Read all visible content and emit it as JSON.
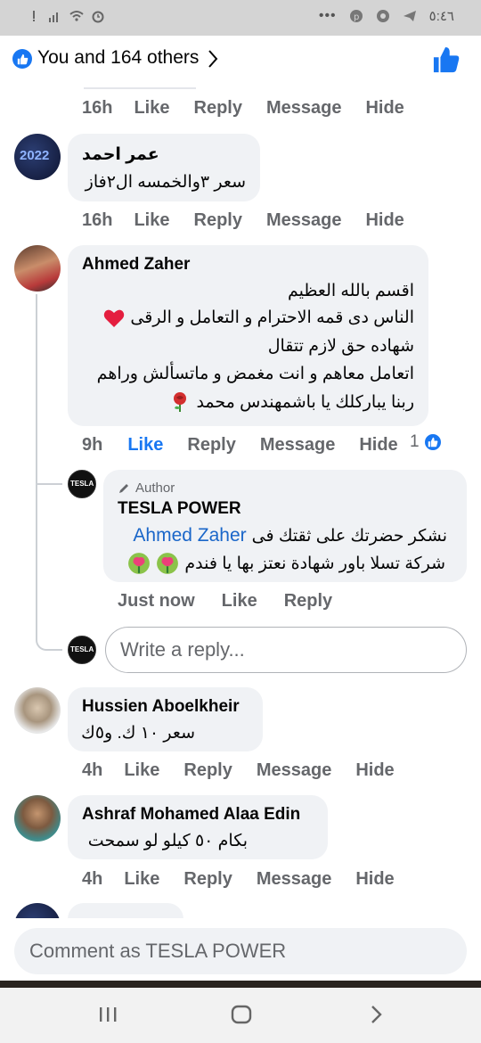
{
  "status_bar": {
    "time": "٥:٤٦",
    "dots": "•••"
  },
  "reactions": {
    "summary": "You and 164 others"
  },
  "comments": [
    {
      "time": "16h",
      "like": "Like",
      "reply": "Reply",
      "message": "Message",
      "hide": "Hide"
    },
    {
      "name": "عمر احمد",
      "lines": [
        "سعر ٣والخمسه ال٢فاز"
      ],
      "time": "16h",
      "like": "Like",
      "reply": "Reply",
      "message": "Message",
      "hide": "Hide",
      "avatar_text": "2022"
    },
    {
      "name": "Ahmed Zaher",
      "lines": [
        "اقسم بالله العظيم",
        "الناس دى قمه الاحترام و التعامل و الرقى",
        "شهاده حق لازم تتقال",
        "اتعامل معاهم و انت مغمض و ماتسألش وراهم",
        "ربنا يباركلك يا باشمهندس محمد"
      ],
      "time": "9h",
      "like": "Like",
      "reply": "Reply",
      "message": "Message",
      "hide": "Hide",
      "reaction_count": "1"
    },
    {
      "name": "Hussien Aboelkheir",
      "lines": [
        "سعر ١٠ ك.  و٥ك"
      ],
      "time": "4h",
      "like": "Like",
      "reply": "Reply",
      "message": "Message",
      "hide": "Hide"
    },
    {
      "name": "Ashraf Mohamed Alaa Edin",
      "lines": [
        "بكام ٥٠ كيلو لو سمحت"
      ],
      "time": "4h",
      "like": "Like",
      "reply": "Reply",
      "message": "Message",
      "hide": "Hide"
    }
  ],
  "author_reply": {
    "badge": "Author",
    "name": "TESLA POWER",
    "mention": "Ahmed Zaher",
    "line1_rest": "نشكر حضرتك على ثقتك فى",
    "line2": "شركة تسلا باور شهادة نعتز بها يا فندم",
    "time": "Just now",
    "like": "Like",
    "reply": "Reply",
    "avatar_text": "TESLA"
  },
  "reply_box": {
    "placeholder": "Write a reply..."
  },
  "comment_box": {
    "placeholder": "Comment as TESLA POWER"
  },
  "colors": {
    "accent": "#1877f2",
    "bubble": "#f0f2f5",
    "meta": "#65676b",
    "heart": "#e41e3f"
  }
}
